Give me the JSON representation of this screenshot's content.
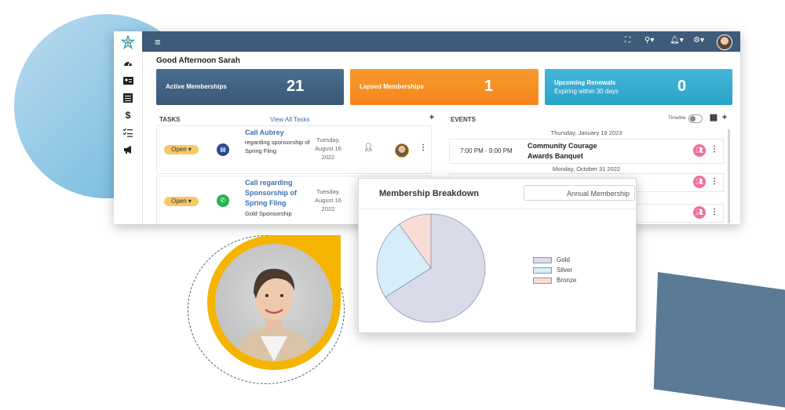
{
  "topbar": {
    "menu_icon": "hamburger-icon",
    "icons": [
      "fullscreen-icon",
      "search-icon",
      "bell-icon",
      "gear-icon"
    ],
    "caret": "▾"
  },
  "sidebar": {
    "icons": [
      "dashboard-icon",
      "id-card-icon",
      "list-icon",
      "dollar-icon",
      "checklist-icon",
      "megaphone-icon"
    ]
  },
  "greeting": "Good Afternoon Sarah",
  "stats": [
    {
      "label": "Active Memberships",
      "value": "21",
      "color": "#4a6d91"
    },
    {
      "label": "Lapsed Memberships",
      "value": "1",
      "color": "#f58a1f"
    },
    {
      "label": "Upcoming Renewals",
      "sublabel": "Expiring within 30 days",
      "value": "0",
      "color": "#37acd1"
    }
  ],
  "tasks": {
    "header": "TASKS",
    "view_all": "View All Tasks",
    "items": [
      {
        "status": "Open ▾",
        "title": "Call Aubrey",
        "desc": "regarding sponsorship of Spring Fling",
        "date": "Tuesday, August 16 2022",
        "icon": "clipboard-icon",
        "icon_color": "#2b4a8f"
      },
      {
        "status": "Open ▾",
        "title": "Call regarding Sponsorship of Spring Fling",
        "desc": "Gold Sponsorship",
        "date": "Tuesday, August 16 2022",
        "icon": "phone-callback-icon",
        "icon_color": "#27b34f"
      }
    ]
  },
  "events": {
    "header": "EVENTS",
    "timeline_label": "Timeline",
    "items": [
      {
        "date": "Thursday, January 19 2023",
        "time": "7:00 PM - 9:00 PM",
        "title": "Community Courage Awards Banquet"
      },
      {
        "date": "Monday, October 31 2022",
        "time": "",
        "title": ""
      }
    ]
  },
  "breakdown": {
    "title": "Membership Breakdown",
    "select_value": "Annual Membership",
    "legend": [
      {
        "name": "Gold",
        "color": "#d9dbe8"
      },
      {
        "name": "Silver",
        "color": "#d6eefa"
      },
      {
        "name": "Bronze",
        "color": "#f8ddd6"
      }
    ]
  },
  "chart_data": {
    "type": "pie",
    "categories": [
      "Gold",
      "Silver",
      "Bronze"
    ],
    "values": [
      66,
      24,
      10
    ],
    "colors": [
      "#d9dbe8",
      "#d6eefa",
      "#f8ddd6"
    ]
  }
}
